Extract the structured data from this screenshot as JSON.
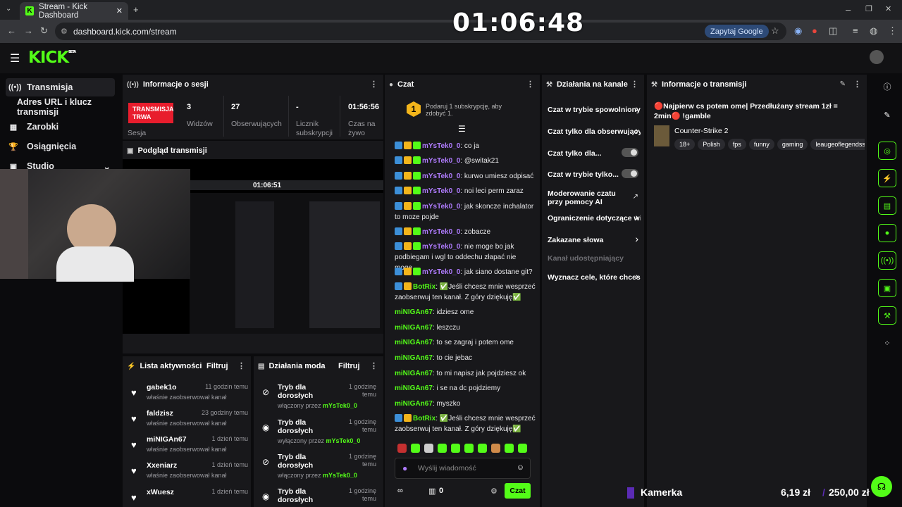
{
  "browser": {
    "tab_title": "Stream - Kick Dashboard",
    "url": "dashboard.kick.com/stream",
    "google_pill": "Zapytaj Google"
  },
  "overlay_clock": "01:06:48",
  "brand": {
    "logo": "KICK",
    "beta": "BETA"
  },
  "sidebar": {
    "items": [
      {
        "label": "Transmisja",
        "icon": "broadcast-icon"
      },
      {
        "label": "Adres URL i klucz transmisji",
        "icon": ""
      },
      {
        "label": "Zarobki",
        "icon": "earnings-icon"
      },
      {
        "label": "Osiągnięcia",
        "icon": "trophy-icon"
      },
      {
        "label": "Studio",
        "icon": "studio-icon"
      }
    ]
  },
  "session": {
    "title": "Informacje o sesji",
    "badge": "TRANSMISJA TRWA",
    "badge_caption": "Sesja",
    "stats": [
      {
        "value": "3",
        "label": "Widzów"
      },
      {
        "value": "27",
        "label": "Obserwujących"
      },
      {
        "value": "-",
        "label": "Licznik subskrypcji"
      },
      {
        "value": "01:56:56",
        "label": "Czas na żywo"
      }
    ]
  },
  "preview": {
    "title": "Podgląd transmisji",
    "inner_clock": "01:06:51"
  },
  "activity": {
    "title": "Lista aktywności",
    "filter": "Filtruj",
    "items": [
      {
        "name": "gabek1o",
        "time": "11 godzin temu",
        "sub": "właśnie zaobserwował kanał"
      },
      {
        "name": "faldzisz",
        "time": "23 godziny temu",
        "sub": "właśnie zaobserwował kanał"
      },
      {
        "name": "miNIGAn67",
        "time": "1 dzień temu",
        "sub": "właśnie zaobserwował kanał"
      },
      {
        "name": "Xxeniarz",
        "time": "1 dzień temu",
        "sub": "właśnie zaobserwował kanał"
      },
      {
        "name": "xWuesz",
        "time": "1 dzień temu",
        "sub": ""
      }
    ]
  },
  "mod": {
    "title": "Działania moda",
    "filter": "Filtruj",
    "items": [
      {
        "title": "Tryb dla dorosłych",
        "time": "1 godzinę temu",
        "sub": "włączony przez",
        "by": "mYsTek0_0",
        "icon": "eye-off-icon"
      },
      {
        "title": "Tryb dla dorosłych",
        "time": "1 godzinę temu",
        "sub": "wyłączony przez",
        "by": "mYsTek0_0",
        "icon": "eye-icon"
      },
      {
        "title": "Tryb dla dorosłych",
        "time": "1 godzinę temu",
        "sub": "włączony przez",
        "by": "mYsTek0_0",
        "icon": "eye-off-icon"
      },
      {
        "title": "Tryb dla dorosłych",
        "time": "1 godzinę temu",
        "sub": "",
        "by": "",
        "icon": "eye-icon"
      }
    ]
  },
  "chat": {
    "title": "Czat",
    "goal": "Podaruj 1 subskrypcję, aby zdobyć 1.",
    "goal_num": "1",
    "messages": [
      {
        "user": "mYsTek0_0",
        "text": "co ja",
        "color": "#b07cff"
      },
      {
        "user": "mYsTek0_0",
        "text": "@switak21",
        "color": "#b07cff"
      },
      {
        "user": "mYsTek0_0",
        "text": "kurwo umiesz odpisać",
        "color": "#b07cff"
      },
      {
        "user": "mYsTek0_0",
        "text": "noi leci perm zaraz",
        "color": "#b07cff"
      },
      {
        "user": "mYsTek0_0",
        "text": "jak skoncze inchalator to moze pojde",
        "color": "#b07cff"
      },
      {
        "user": "mYsTek0_0",
        "text": "zobacze",
        "color": "#b07cff"
      },
      {
        "user": "mYsTek0_0",
        "text": "nie moge bo jak podbiegam i wgl to oddechu złapać nie moge",
        "color": "#b07cff"
      },
      {
        "user": "mYsTek0_0",
        "text": "jak siano dostane git?",
        "color": "#b07cff"
      },
      {
        "user": "BotRix",
        "text": "✅Jeśli chcesz mnie wesprzeć zaobserwuj ten kanał. Z góry dziękuję✅",
        "color": "#53fc18"
      },
      {
        "user": "miNIGAn67",
        "text": "idziesz ome",
        "color": "#53fc18"
      },
      {
        "user": "miNIGAn67",
        "text": "leszczu",
        "color": "#53fc18"
      },
      {
        "user": "miNIGAn67",
        "text": "to se zagraj i potem ome",
        "color": "#53fc18"
      },
      {
        "user": "miNIGAn67",
        "text": "to cie jebac",
        "color": "#53fc18"
      },
      {
        "user": "miNIGAn67",
        "text": "to mi napisz jak pojdziesz ok",
        "color": "#53fc18"
      },
      {
        "user": "miNIGAn67",
        "text": "i se na dc pojdziemy",
        "color": "#53fc18"
      },
      {
        "user": "miNIGAn67",
        "text": "myszko",
        "color": "#53fc18"
      },
      {
        "user": "BotRix",
        "text": "✅Jeśli chcesz mnie wesprzeć zaobserwuj ten kanał. Z góry dziękuję✅",
        "color": "#53fc18"
      }
    ],
    "input_placeholder": "Wyślij wiadomość",
    "points": "0",
    "send": "Czat"
  },
  "channel": {
    "title": "Działania na kanale",
    "rows": [
      {
        "label": "Czat w trybie spowolnionym",
        "kind": "chevron"
      },
      {
        "label": "Czat tylko dla obserwujących",
        "kind": "chevron"
      },
      {
        "label": "Czat tylko dla...",
        "kind": "toggle"
      },
      {
        "label": "Czat w trybie tylko...",
        "kind": "toggle"
      },
      {
        "label": "Moderowanie czatu przy pomocy AI",
        "kind": "link"
      },
      {
        "label": "Ograniczenie dotyczące wieku",
        "kind": "chevron"
      },
      {
        "label": "Zakazane słowa",
        "kind": "chevron"
      },
      {
        "label": "Kanał udostępniający",
        "kind": "disabled"
      },
      {
        "label": "Wyznacz cele, które chcesz",
        "kind": "chevron"
      }
    ]
  },
  "info": {
    "title": "Informacje o transmisji",
    "stream_title": "🔴Najpierw cs potem ome| Przedłużany stream 1zł = 2min🔴 !gamble",
    "category": "Counter-Strike 2",
    "tags": [
      "18+",
      "Polish",
      "fps",
      "funny",
      "gaming",
      "leaugeoflegendssolo"
    ]
  },
  "bottom": {
    "kamerka": "Kamerka",
    "amount1": "6,19 zł",
    "amount2": "250,00 zł"
  },
  "colors": {
    "accent": "#53fc18",
    "live": "#e81d2d",
    "panel": "#18181b"
  }
}
